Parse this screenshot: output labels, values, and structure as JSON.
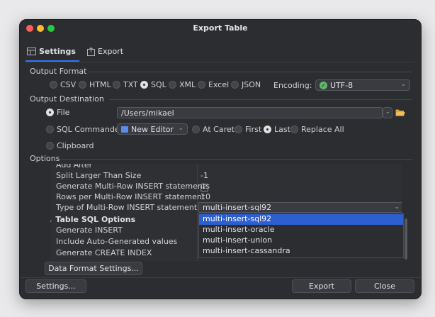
{
  "window": {
    "title": "Export Table"
  },
  "tabs": [
    {
      "label": "Settings",
      "icon": "settings-tab-icon"
    },
    {
      "label": "Export",
      "icon": "export-tab-icon"
    }
  ],
  "output_format": {
    "section_label": "Output Format",
    "options": [
      "CSV",
      "HTML",
      "TXT",
      "SQL",
      "XML",
      "Excel",
      "JSON"
    ],
    "selected": "SQL",
    "encoding_label": "Encoding:",
    "encoding_value": "UTF-8"
  },
  "output_destination": {
    "section_label": "Output Destination",
    "file_label": "File",
    "file_path": "/Users/mikael",
    "sql_commander_label": "SQL Commander",
    "editor_value": "New Editor",
    "at_caret_label": "At Caret",
    "first_label": "First",
    "last_label": "Last",
    "replace_all_label": "Replace All",
    "clipboard_label": "Clipboard"
  },
  "options": {
    "section_label": "Options",
    "rows": [
      {
        "name": "Add After",
        "value": ""
      },
      {
        "name": "Split Larger Than Size",
        "value": "-1"
      },
      {
        "name": "Generate Multi-Row INSERT statements",
        "value": "✓"
      },
      {
        "name": "Rows per Multi-Row INSERT statement",
        "value": "10"
      },
      {
        "name": "Type of Multi-Row INSERT statement",
        "value": "multi-insert-sql92"
      },
      {
        "name": "Table SQL Options",
        "value": ""
      },
      {
        "name": "Generate INSERT",
        "value": ""
      },
      {
        "name": "Include Auto-Generated values",
        "value": ""
      },
      {
        "name": "Generate CREATE INDEX",
        "value": ""
      }
    ],
    "dropdown_options": [
      "multi-insert-sql92",
      "multi-insert-oracle",
      "multi-insert-union",
      "multi-insert-cassandra"
    ],
    "dropdown_selected": "multi-insert-sql92",
    "data_format_button": "Data Format Settings..."
  },
  "footer": {
    "settings_button": "Settings...",
    "export_button": "Export",
    "close_button": "Close"
  },
  "colors": {
    "accent": "#3574f0",
    "selection": "#2e5fd0",
    "window_bg": "#2b2d30",
    "check_green": "#5fb865",
    "folder_orange": "#e3a33b"
  }
}
